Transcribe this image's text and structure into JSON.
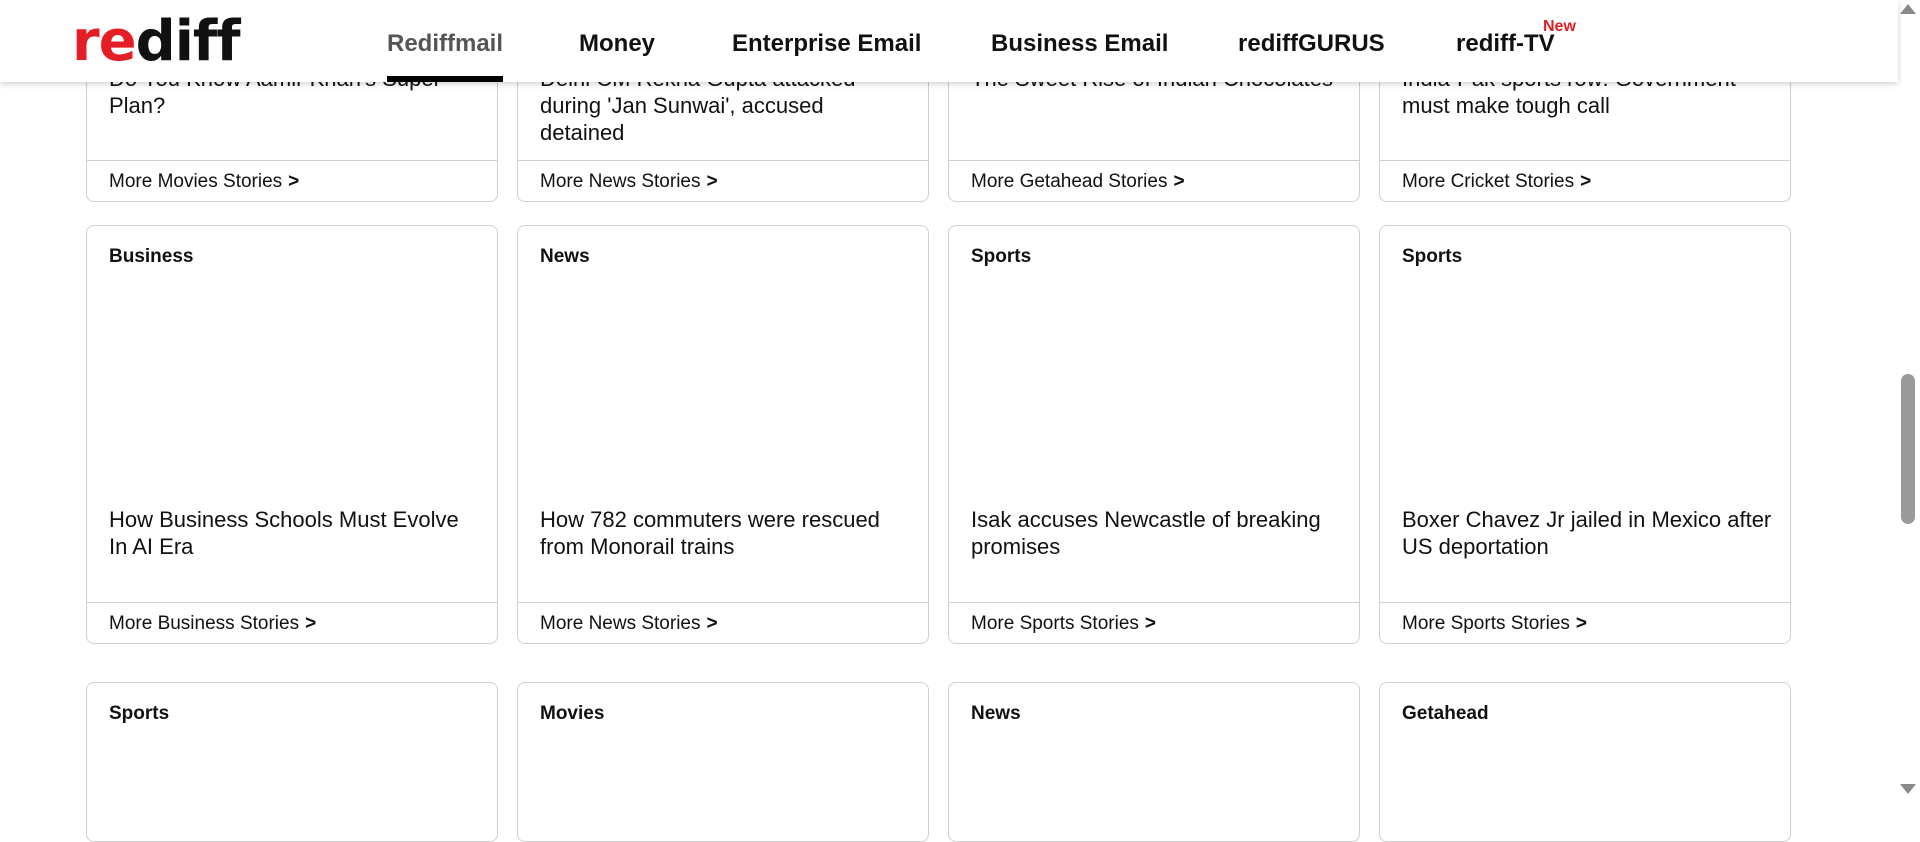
{
  "header": {
    "logo": {
      "part1": "re",
      "part2": "diff"
    },
    "nav": [
      {
        "label": "Rediffmail"
      },
      {
        "label": "Money"
      },
      {
        "label": "Enterprise Email"
      },
      {
        "label": "Business Email"
      },
      {
        "label": "rediffGURUS"
      },
      {
        "label": "rediff-TV",
        "badge": "New"
      }
    ]
  },
  "cards_row1": [
    {
      "headline": "Do You Know Aamir Khan's Super Plan?",
      "more": "More Movies Stories"
    },
    {
      "headline": "Delhi CM Rekha Gupta attacked during 'Jan Sunwai', accused detained",
      "more": "More News Stories"
    },
    {
      "headline": "The Sweet Rise of Indian Chocolates",
      "more": "More Getahead Stories"
    },
    {
      "headline": "India-Pak sports row: Government must make tough call",
      "more": "More Cricket Stories"
    }
  ],
  "cards_row2": [
    {
      "category": "Business",
      "headline": "How Business Schools Must Evolve In AI Era",
      "more": "More Business Stories"
    },
    {
      "category": "News",
      "headline": "How 782 commuters were rescued from Monorail trains",
      "more": "More News Stories"
    },
    {
      "category": "Sports",
      "headline": "Isak accuses Newcastle of breaking promises",
      "more": "More Sports Stories"
    },
    {
      "category": "Sports",
      "headline": "Boxer Chavez Jr jailed in Mexico after US deportation",
      "more": "More Sports Stories"
    }
  ],
  "cards_row3": [
    {
      "category": "Sports"
    },
    {
      "category": "Movies"
    },
    {
      "category": "News"
    },
    {
      "category": "Getahead"
    }
  ],
  "more_chevron": ">",
  "colors": {
    "brand_red": "#e31e24",
    "border": "#d0d0d0"
  }
}
